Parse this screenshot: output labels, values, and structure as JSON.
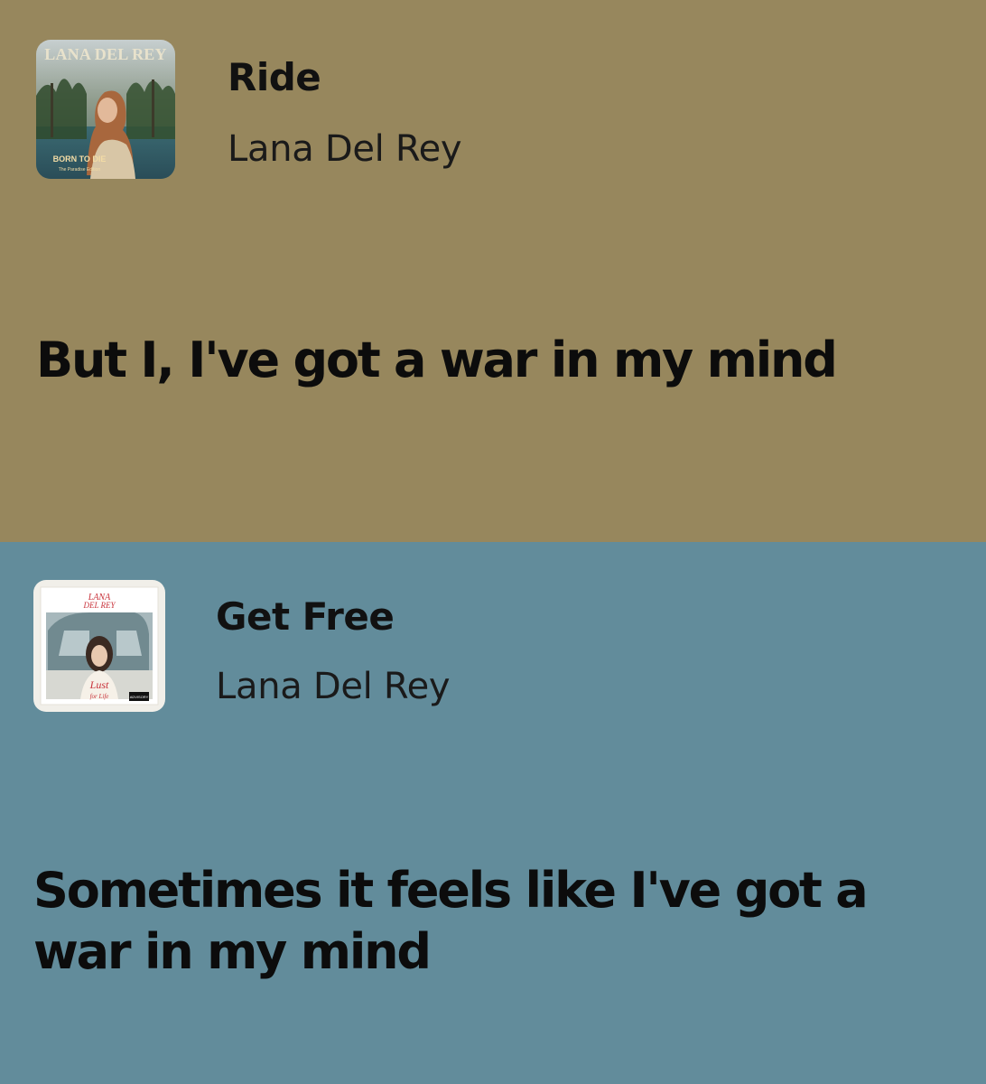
{
  "cards": [
    {
      "song": {
        "title": "Ride",
        "artist": "Lana Del Rey"
      },
      "lyric": "But I, I've got a war in my mind",
      "background_color": "#97875d",
      "cover": {
        "icon": "album-cover-born-to-die-paradise-edition",
        "text_top": "LANA DEL REY",
        "text_bottom": "BORN TO DIE",
        "text_small": "The Paradise Edition"
      }
    },
    {
      "song": {
        "title": "Get Free",
        "artist": "Lana Del Rey"
      },
      "lyric": "Sometimes it feels like I've got a war in my mind",
      "background_color": "#628c9b",
      "cover": {
        "icon": "album-cover-lust-for-life",
        "text_top": "LANA DEL REY",
        "text_bottom": "Lust for Life",
        "text_small": "PARENTAL ADVISORY"
      }
    }
  ]
}
